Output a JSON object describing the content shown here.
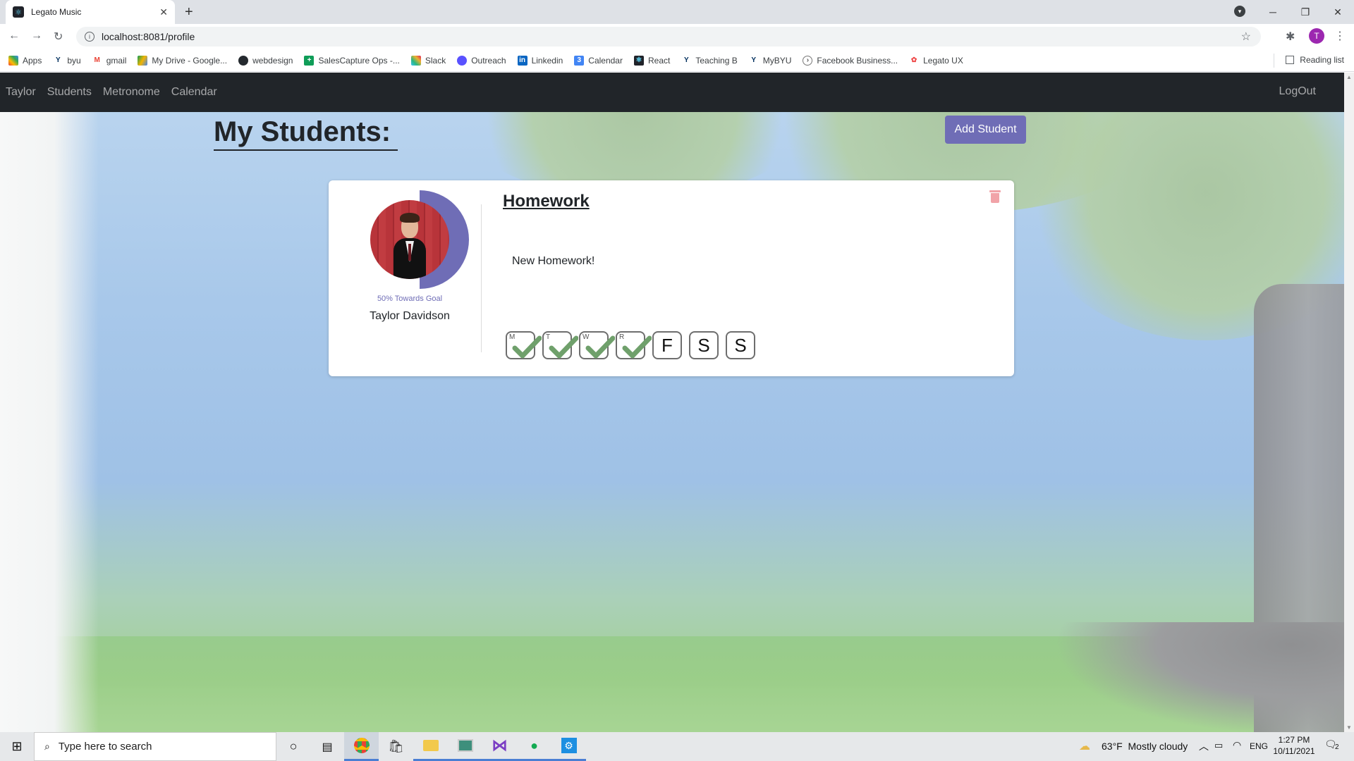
{
  "browser": {
    "tab_title": "Legato Music",
    "url": "localhost:8081/profile",
    "profile_initial": "T",
    "bookmarks": [
      "Apps",
      "byu",
      "gmail",
      "My Drive - Google...",
      "webdesign",
      "SalesCapture Ops -...",
      "Slack",
      "Outreach",
      "Linkedin",
      "Calendar",
      "React",
      "Teaching B",
      "MyBYU",
      "Facebook Business...",
      "Legato UX"
    ],
    "reading_list": "Reading list"
  },
  "navbar": {
    "links": [
      "Taylor",
      "Students",
      "Metronome",
      "Calendar"
    ],
    "logout": "LogOut"
  },
  "main": {
    "heading": "My Students:",
    "add_student_label": "Add Student"
  },
  "student_card": {
    "goal_text": "50% Towards Goal",
    "goal_progress": 0.5,
    "name": "Taylor Davidson",
    "homework_title": "Homework",
    "homework_text": "New Homework!",
    "days": [
      {
        "letter": "M",
        "done": true
      },
      {
        "letter": "T",
        "done": true
      },
      {
        "letter": "W",
        "done": true
      },
      {
        "letter": "R",
        "done": true
      },
      {
        "letter": "F",
        "done": false
      },
      {
        "letter": "S",
        "done": false
      },
      {
        "letter": "S",
        "done": false
      }
    ]
  },
  "taskbar": {
    "search_placeholder": "Type here to search",
    "weather": "63°F  Mostly cloudy",
    "language": "ENG",
    "time": "1:27 PM",
    "date": "10/11/2021",
    "notifications": "2"
  },
  "colors": {
    "accent": "#6f6db6",
    "navbar_bg": "#212529",
    "check_green": "#6fa06b"
  }
}
